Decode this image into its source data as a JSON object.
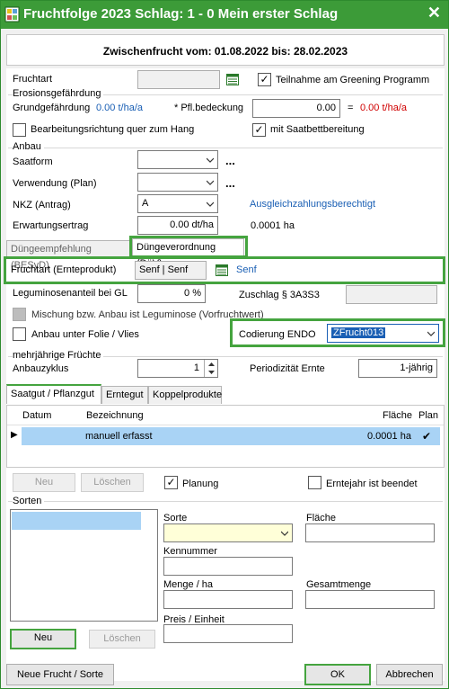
{
  "window": {
    "title": "Fruchtfolge 2023 Schlag: 1 - 0 Mein erster Schlag",
    "close_glyph": "✕"
  },
  "header": {
    "zwischenfrucht": "Zwischenfrucht vom: 01.08.2022 bis: 28.02.2023"
  },
  "fruchtart": {
    "label": "Fruchtart",
    "value": "",
    "greening_label": "Teilnahme am Greening Programm",
    "greening_checked": true
  },
  "erosion": {
    "section_title": "Erosionsgefährdung",
    "grund_label": "Grundgefährdung",
    "grund_value": "0.00 t/ha/a",
    "pfl_label": "* Pfl.bedeckung",
    "pfl_value": "0.00",
    "eq": "=",
    "result_value": "0.00 t/ha/a",
    "quer_label": "Bearbeitungsrichtung quer zum Hang",
    "quer_checked": false,
    "saatbett_label": "mit Saatbettbereitung",
    "saatbett_checked": true
  },
  "anbau": {
    "section_title": "Anbau",
    "saatform_label": "Saatform",
    "saatform_value": "",
    "verwendung_label": "Verwendung (Plan)",
    "verwendung_value": "",
    "ellipsis": "...",
    "nkz_label": "NKZ  (Antrag)",
    "nkz_value": "A",
    "ausgleich_label": "Ausgleichzahlungsberechtigt",
    "ertrag_label": "Erwartungsertrag",
    "ertrag_value": "0.00 dt/ha",
    "ertrag_area": "0.0001 ha"
  },
  "tabs_duenge": {
    "tab1": "Düngeempfehlung (BESyD)",
    "tab2": "Düngeverordnung (DüV)"
  },
  "duev": {
    "fruchtart_label": "Fruchtart (Ernteprodukt)",
    "fruchtart_value": "Senf | Senf",
    "fruchtart_link": "Senf",
    "legum_label": "Leguminosenanteil bei GL",
    "legum_value": "0 %",
    "zuschlag_label": "Zuschlag § 3A3S3",
    "zuschlag_value": "",
    "mischung_label": "Mischung bzw. Anbau ist Leguminose (Vorfruchtwert)",
    "folie_label": "Anbau unter Folie / Vlies",
    "folie_checked": false,
    "codierung_label": "Codierung ENDO",
    "codierung_value": "ZFrucht013"
  },
  "mehrjaehrig": {
    "section_title": "mehrjährige Früchte",
    "anbauzyklus_label": "Anbauzyklus",
    "anbauzyklus_value": "1",
    "period_label": "Periodizität Ernte",
    "period_value": "1-jährig"
  },
  "tabs_saat": {
    "tab1": "Saatgut / Pflanzgut",
    "tab2": "Erntegut",
    "tab3": "Koppelprodukte"
  },
  "table": {
    "col_datum": "Datum",
    "col_bezeichnung": "Bezeichnung",
    "col_flaeche": "Fläche",
    "col_plan": "Plan",
    "row_marker": "▶",
    "rows": [
      {
        "datum": "",
        "bezeichnung": "manuell erfasst",
        "flaeche": "0.0001 ha",
        "plan": "✔"
      }
    ]
  },
  "saat_actions": {
    "neu": "Neu",
    "loeschen": "Löschen",
    "planung_label": "Planung",
    "planung_checked": true,
    "erntejahr_label": "Erntejahr ist beendet",
    "erntejahr_checked": false
  },
  "sorten": {
    "section_title": "Sorten",
    "sorte_label": "Sorte",
    "sorte_value": "",
    "flaeche_label": "Fläche",
    "flaeche_value": "",
    "kennnummer_label": "Kennummer",
    "kennnummer_value": "",
    "menge_label": "Menge / ha",
    "menge_value": "",
    "gesamt_label": "Gesamtmenge",
    "gesamt_value": "",
    "preis_label": "Preis / Einheit",
    "preis_value": "",
    "neu": "Neu",
    "loeschen": "Löschen"
  },
  "footer": {
    "neue_frucht": "Neue Frucht / Sorte",
    "ok": "OK",
    "abbrechen": "Abbrechen"
  },
  "colors": {
    "titlebar": "#3c9b38",
    "highlight_outline": "#45a43f",
    "link_blue": "#1a5fb4",
    "value_red": "#d00000",
    "selection_blue": "#a9d3f5"
  }
}
